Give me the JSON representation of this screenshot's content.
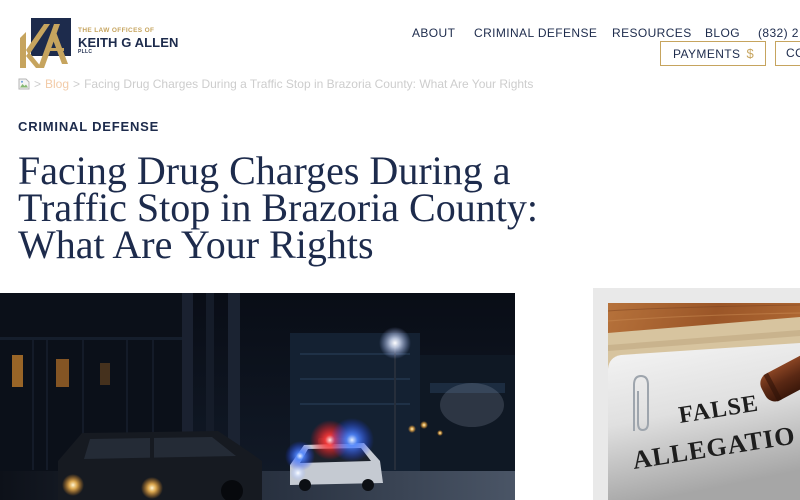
{
  "theme": {
    "navy": "#1d2b4c",
    "gold": "#c6a45e",
    "breadcrumb_link": "#f2cba8",
    "breadcrumb_text": "#cdcdcd",
    "card_bg": "#e9e9e9"
  },
  "header": {
    "logo": {
      "icon": "logo-monogram",
      "tagline": "THE LAW OFFICES OF",
      "name": "KEITH G ALLEN",
      "suffix": "PLLC"
    },
    "nav": [
      {
        "label": "ABOUT"
      },
      {
        "label": "CRIMINAL DEFENSE"
      },
      {
        "label": "RESOURCES"
      },
      {
        "label": "BLOG"
      },
      {
        "label": "(832) 2"
      }
    ],
    "payments_button": {
      "label": "PAYMENTS",
      "symbol": "$",
      "icon": "dollar-sign-icon"
    },
    "contact_button": {
      "label": "CO"
    }
  },
  "breadcrumb": {
    "home_icon": "broken-image-icon",
    "separator": ">",
    "items": [
      {
        "label": "Blog"
      },
      {
        "label": "Facing Drug Charges During a Traffic Stop in Brazoria County: What Are Your Rights"
      }
    ]
  },
  "article": {
    "category": "CRIMINAL DEFENSE",
    "title": "Facing Drug Charges During a Traffic Stop in Brazoria County: What Are Your Rights"
  },
  "sidebar_card": {
    "image_lettering": [
      "FALSE",
      "ALLEGATIO"
    ]
  }
}
